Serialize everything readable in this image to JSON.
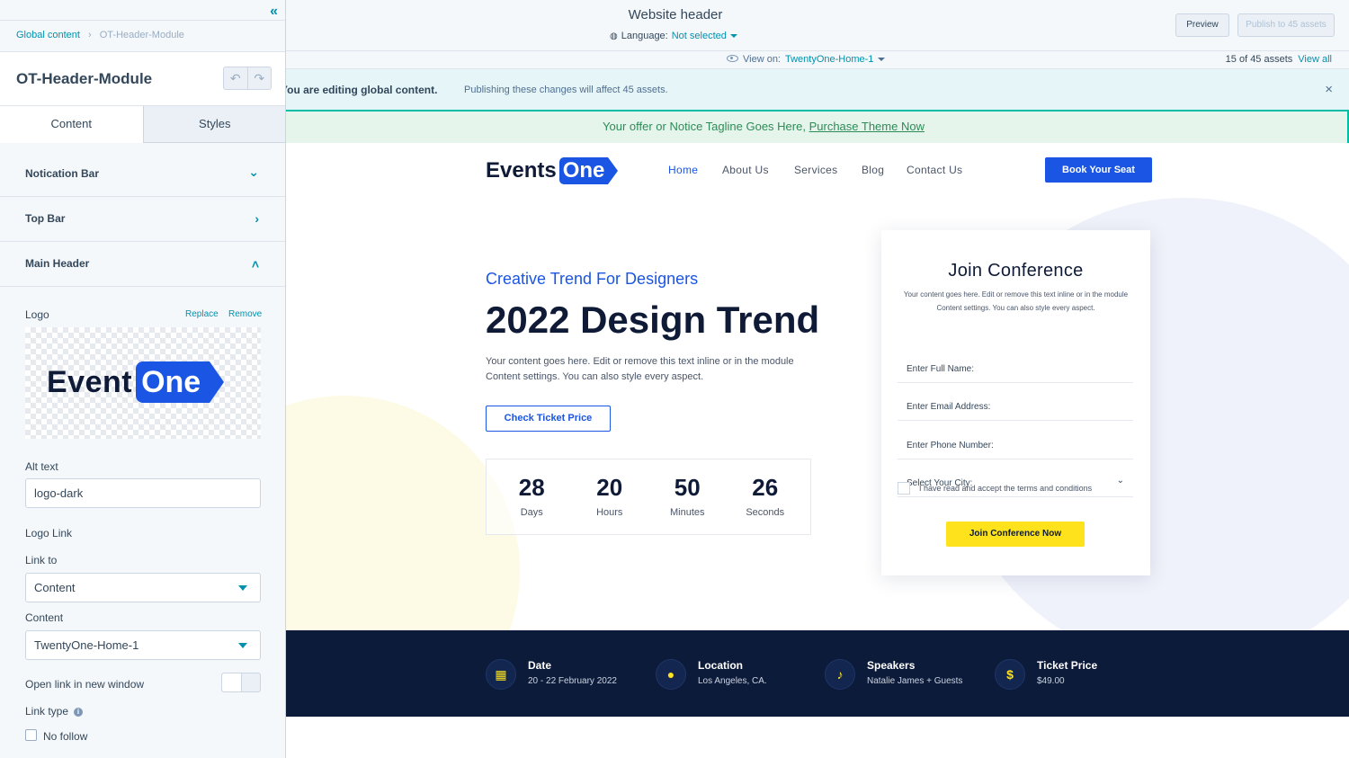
{
  "sidebar": {
    "breadcrumb": {
      "root": "Global content",
      "current": "OT-Header-Module"
    },
    "title": "OT-Header-Module",
    "tabs": [
      "Content",
      "Styles"
    ],
    "sections": [
      {
        "label": "Notication Bar",
        "state": "collapsed-down"
      },
      {
        "label": "Top Bar",
        "state": "collapsed-right"
      },
      {
        "label": "Main Header",
        "state": "expanded"
      }
    ],
    "logo": {
      "label": "Logo",
      "replace": "Replace",
      "remove": "Remove",
      "preview_word1": "Event",
      "preview_word2": "One"
    },
    "alt_text": {
      "label": "Alt text",
      "value": "logo-dark"
    },
    "logo_link": {
      "label": "Logo Link",
      "link_to_label": "Link to",
      "link_to_value": "Content",
      "content_label": "Content",
      "content_value": "TwentyOne-Home-1"
    },
    "open_new_window": {
      "label": "Open link in new window",
      "on": false
    },
    "link_type": {
      "label": "Link type"
    },
    "no_follow": {
      "label": "No follow",
      "checked": false
    }
  },
  "topbar": {
    "title": "Website header",
    "language_label": "Language:",
    "language_value": "Not selected",
    "preview": "Preview",
    "publish": "Publish to 45 assets"
  },
  "viewbar": {
    "view_label": "View on:",
    "view_value": "TwentyOne-Home-1",
    "count": "15 of 45 assets",
    "view_all": "View all"
  },
  "alert": {
    "bold": "You are editing global content.",
    "text": "Publishing these changes will affect 45 assets.",
    "close": "×"
  },
  "site": {
    "notice": {
      "text": "Your offer or Notice Tagline Goes Here,",
      "link": "Purchase Theme Now"
    },
    "logo": {
      "word1": "Events",
      "word2": "One"
    },
    "nav": [
      "Home",
      "About Us",
      "Services",
      "Blog",
      "Contact Us"
    ],
    "cta": "Book Your Seat",
    "hero": {
      "subtitle": "Creative Trend For Designers",
      "title": "2022 Design Trend",
      "desc": "Your content goes here. Edit or remove this text inline or in the module Content settings. You can also style every aspect.",
      "button": "Check Ticket Price"
    },
    "countdown": [
      {
        "value": "28",
        "label": "Days"
      },
      {
        "value": "20",
        "label": "Hours"
      },
      {
        "value": "50",
        "label": "Minutes"
      },
      {
        "value": "26",
        "label": "Seconds"
      }
    ],
    "form": {
      "title": "Join Conference",
      "desc": "Your content goes here. Edit or remove this text inline or in the module Content settings. You can also style every aspect.",
      "fields": [
        "Enter Full Name:",
        "Enter Email Address:",
        "Enter Phone Number:"
      ],
      "city": "Select Your City:",
      "terms": "I have read and accept the terms and conditions",
      "submit": "Join Conference Now"
    },
    "info": [
      {
        "icon": "calendar-icon",
        "head": "Date",
        "value": "20 - 22 February 2022"
      },
      {
        "icon": "location-pin-icon",
        "head": "Location",
        "value": "Los Angeles, CA."
      },
      {
        "icon": "microphone-icon",
        "head": "Speakers",
        "value": "Natalie James + Guests"
      },
      {
        "icon": "dollar-icon",
        "head": "Ticket Price",
        "value": "$49.00"
      }
    ]
  },
  "colors": {
    "accent": "#0091ae",
    "brand_blue": "#1a55e3",
    "brand_navy": "#0d1b3a",
    "brand_yellow": "#fde21c",
    "notice_green": "#2e8b57"
  }
}
